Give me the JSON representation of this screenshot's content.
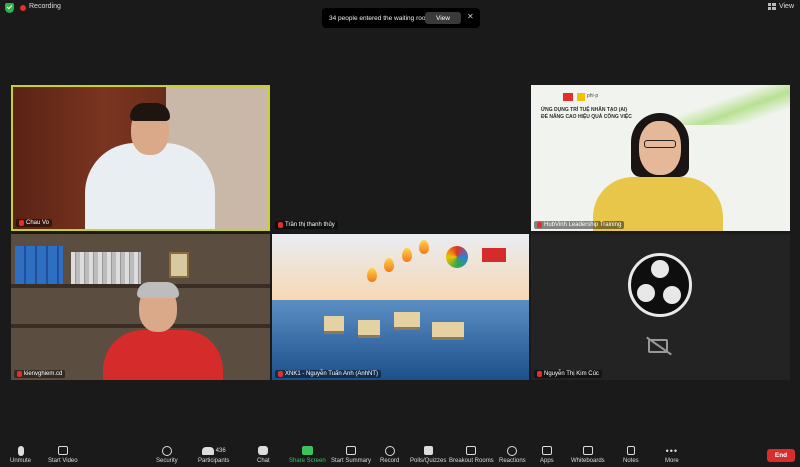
{
  "topbar": {
    "recording_label": "Recording",
    "view_label": "View"
  },
  "waiting_banner": {
    "message": "34 people entered the waiting room",
    "view_label": "View",
    "close_glyph": "✕"
  },
  "tiles": [
    {
      "name": "Chau Vo"
    },
    {
      "name": "Trần thị thanh thủy"
    },
    {
      "name": "HubVinh Leadership Training"
    },
    {
      "name": "kienvghiem.cd"
    },
    {
      "name": "XNK1 - Nguyễn Tuấn Anh (AnhNT)"
    },
    {
      "name": "Nguyễn Thị Kim Cúc"
    }
  ],
  "slide": {
    "logo_text": "phi·p",
    "title_line1": "ỨNG DỤNG TRÍ TUỆ NHÂN TẠO (AI)",
    "title_line2": "ĐỂ NÂNG CAO HIỆU QUẢ CÔNG VIỆC"
  },
  "toolbar": {
    "unmute": "Unmute",
    "start_video": "Start Video",
    "security": "Security",
    "participants": "Participants",
    "participants_count": "436",
    "chat": "Chat",
    "share_screen": "Share Screen",
    "start_summary": "Start Summary",
    "record": "Record",
    "polls": "Polls/Quizzes",
    "breakout": "Breakout Rooms",
    "reactions": "Reactions",
    "apps": "Apps",
    "whiteboards": "Whiteboards",
    "notes": "Notes",
    "more": "More",
    "end": "End"
  },
  "colors": {
    "active_speaker_border": "#c8d02a",
    "share_green": "#3fc25c",
    "end_red": "#d92d2d",
    "recording_red": "#e0302b"
  }
}
